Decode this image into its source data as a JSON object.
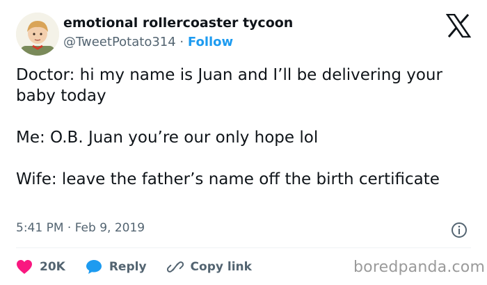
{
  "author": {
    "display_name": "emotional rollercoaster tycoon",
    "handle": "@TweetPotato314",
    "separator": "·",
    "follow_label": "Follow",
    "avatar_icon": "child-avatar"
  },
  "platform_icon": "x-logo-icon",
  "tweet": {
    "lines": [
      "Doctor: hi my name is Juan and I’ll be delivering your baby today",
      "Me: O.B. Juan you’re our only hope lol",
      "Wife: leave the father’s name off the birth certificate"
    ]
  },
  "meta": {
    "timestamp": "5:41 PM · Feb 9, 2019",
    "info_icon": "info-icon"
  },
  "actions": {
    "likes_count": "20K",
    "reply_label": "Reply",
    "copy_link_label": "Copy link"
  },
  "colors": {
    "accent": "#1d9bf0",
    "like": "#f91880",
    "muted": "#536471"
  },
  "watermark": "boredpanda.com"
}
